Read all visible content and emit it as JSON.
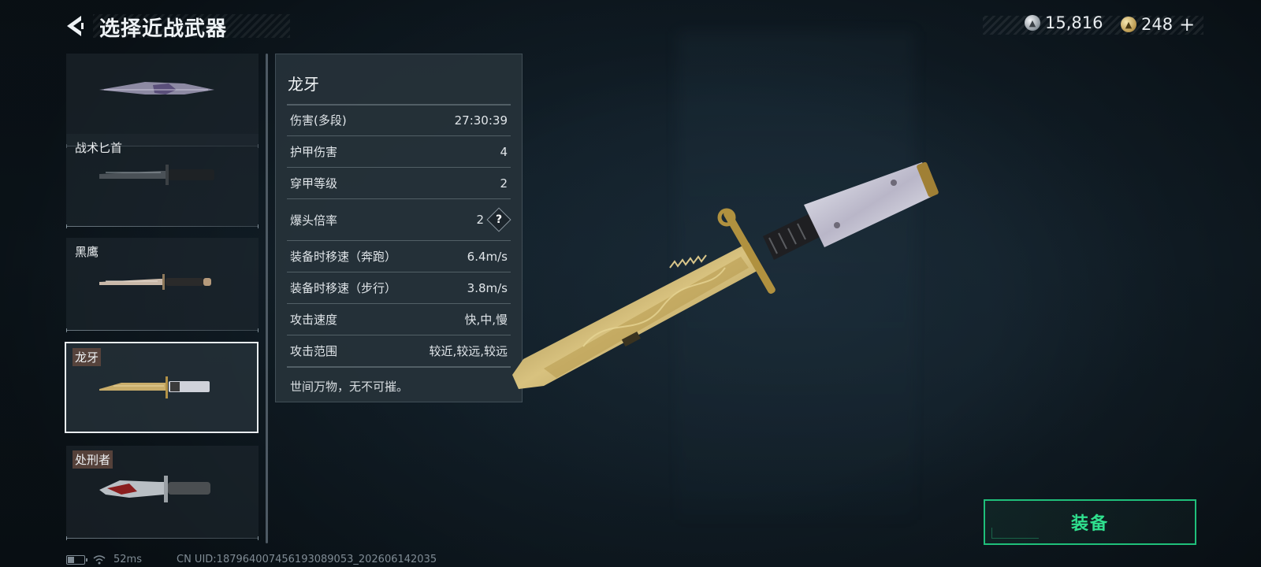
{
  "header": {
    "title": "选择近战武器",
    "back_icon": "chevron-left-icon"
  },
  "currency": {
    "silver_icon": "silver-coin-icon",
    "silver_amount": "15,816",
    "gold_icon": "gold-coin-icon",
    "gold_amount": "248",
    "plus_label": "+"
  },
  "weapons": [
    {
      "name": "",
      "icon": "knife-1-icon",
      "selected": false
    },
    {
      "name": "战术匕首",
      "icon": "knife-tactical-icon",
      "selected": false
    },
    {
      "name": "黑鹰",
      "icon": "knife-blackhawk-icon",
      "selected": false
    },
    {
      "name": "龙牙",
      "icon": "knife-dragonfang-icon",
      "selected": true
    },
    {
      "name": "处刑者",
      "icon": "knife-executioner-icon",
      "selected": false
    }
  ],
  "detail": {
    "title": "龙牙",
    "stats": [
      {
        "label": "伤害(多段)",
        "value": "27:30:39"
      },
      {
        "label": "护甲伤害",
        "value": "4"
      },
      {
        "label": "穿甲等级",
        "value": "2"
      },
      {
        "label": "爆头倍率",
        "value": "2",
        "help": "?"
      },
      {
        "label": "装备时移速（奔跑）",
        "value": "6.4m/s"
      },
      {
        "label": "装备时移速（步行）",
        "value": "3.8m/s"
      },
      {
        "label": "攻击速度",
        "value": "快,中,慢"
      },
      {
        "label": "攻击范围",
        "value": "较近,较远,较远"
      }
    ],
    "description": "世间万物，无不可摧。"
  },
  "equip": {
    "label": "装备"
  },
  "status": {
    "ping": "52ms",
    "uid": "CN UID:18796400745619308905​3_202606142035",
    "battery_fraction": 0.4
  },
  "colors": {
    "accent": "#1fbf7a",
    "accent_text": "#2fe08e",
    "panel": "#26323a",
    "tag": "#60483e"
  }
}
